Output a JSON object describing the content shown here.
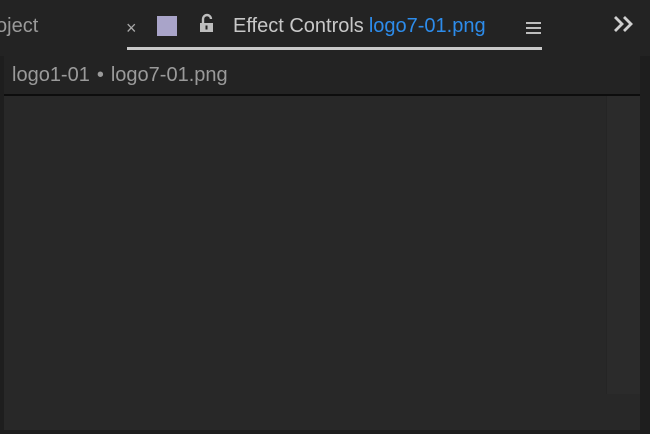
{
  "tabs": {
    "project_label": "oject",
    "close_symbol": "×",
    "label_color": "#a9a4c9",
    "lock_icon": "lock-open-icon",
    "effect_controls_label": "Effect Controls",
    "effect_controls_clip": "logo7-01.png",
    "menu_icon": "hamburger-menu-icon",
    "overflow_icon": "double-chevron-right-icon"
  },
  "breadcrumb": {
    "sequence": "logo1-01",
    "separator": "•",
    "clip": "logo7-01.png"
  },
  "colors": {
    "panel_bg": "#282828",
    "tabbar_bg": "#232323",
    "accent_blue": "#2d8ceb",
    "active_underline": "#c9c9c9"
  }
}
